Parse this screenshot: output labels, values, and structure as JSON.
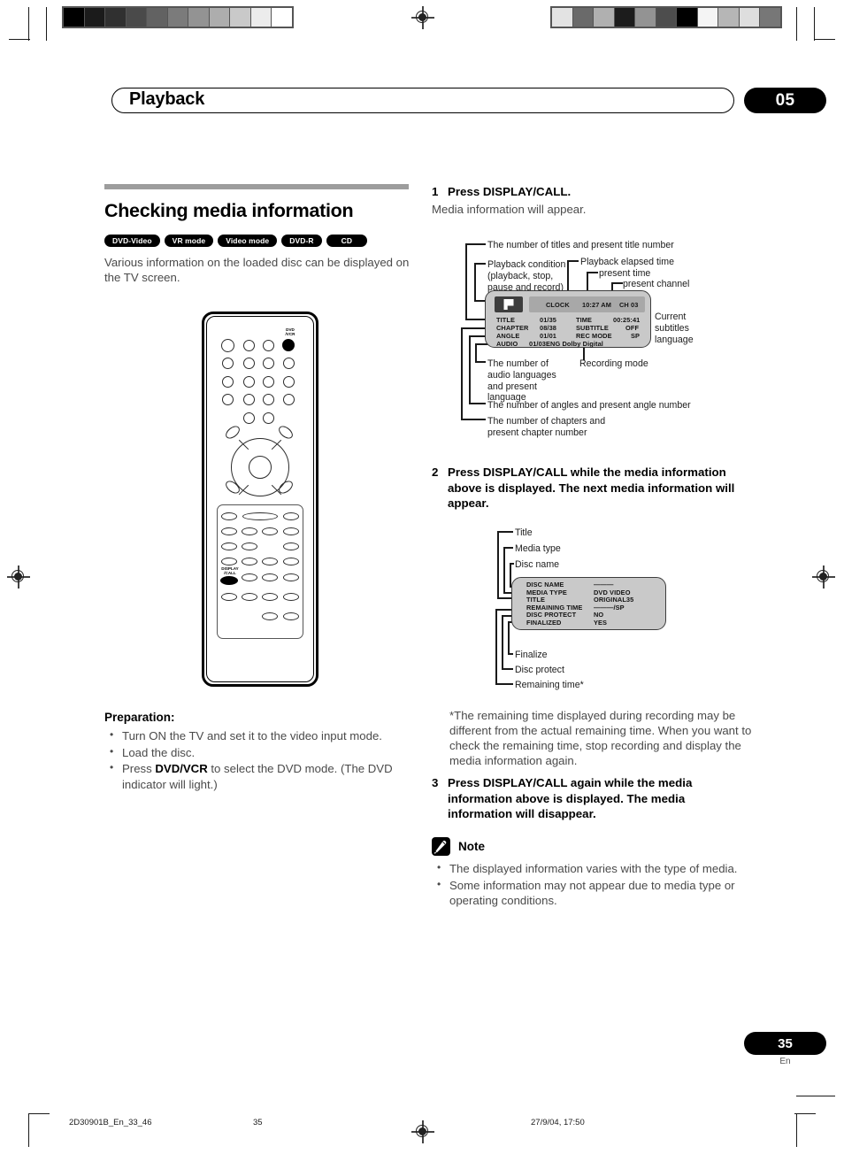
{
  "header": {
    "chapter_title": "Playback",
    "chapter_number": "05"
  },
  "left_column": {
    "section_title": "Checking media information",
    "badges": [
      {
        "label": "DVD-Video"
      },
      {
        "label": "VR mode"
      },
      {
        "label": "Video mode"
      },
      {
        "label": "DVD-R"
      },
      {
        "label": "CD"
      }
    ],
    "intro": "Various information on the loaded disc can be displayed on the TV screen.",
    "preparation_heading": "Preparation:",
    "preparation_items": [
      "Turn ON the TV and set it to the video input mode.",
      "Load the disc."
    ],
    "preparation_item_3_pre": "Press ",
    "preparation_item_3_bold": "DVD/VCR",
    "preparation_item_3_post": " to select the DVD mode. (The DVD indicator will light.)"
  },
  "remote": {
    "label_dvd_vcr": "DVD\n/VCR",
    "label_display_call": "DISPLAY\n/CALL"
  },
  "right_column": {
    "step1": {
      "number": "1",
      "text": "Press DISPLAY/CALL.",
      "sub": "Media information will appear."
    },
    "step2": {
      "number": "2",
      "text": "Press DISPLAY/CALL while the media information above is displayed. The next media information will appear."
    },
    "step3": {
      "number": "3",
      "text": "Press DISPLAY/CALL again while the media information above is displayed. The media information will disappear."
    },
    "footnote": "*The remaining time displayed during recording may be different from the actual remaining time. When you want to check the remaining time, stop recording and display the media information again.",
    "note": {
      "label": "Note",
      "items": [
        "The displayed information varies with the type of media.",
        "Some information may not appear due to media type or operating conditions."
      ]
    }
  },
  "figure1": {
    "callouts": {
      "titles": "The number of titles and present title number",
      "playback_condition": "Playback condition\n(playback, stop,\npause and record)",
      "elapsed": "Playback elapsed time",
      "present_time": "present time",
      "present_channel": "present channel",
      "current_subtitles": "Current\nsubtitles\nlanguage",
      "recording_mode": "Recording mode",
      "audio_langs": "The number of\naudio languages\nand present\nlanguage",
      "angles": "The number of angles and present angle number",
      "chapters": "The number of chapters and\npresent chapter number"
    },
    "osd": {
      "clock_label": "CLOCK",
      "clock_time": "10:27 AM",
      "channel": "CH 03",
      "rows_left": [
        {
          "label": "TITLE",
          "value": "01/35"
        },
        {
          "label": "CHAPTER",
          "value": "08/38"
        },
        {
          "label": "ANGLE",
          "value": "01/01"
        },
        {
          "label": "AUDIO",
          "value": "01/03ENG Dolby Digital"
        }
      ],
      "rows_right": [
        {
          "label": "TIME",
          "value": "00:25:41"
        },
        {
          "label": "SUBTITLE",
          "value": "OFF"
        },
        {
          "label": "REC MODE",
          "value": "SP"
        }
      ]
    }
  },
  "figure2": {
    "callouts": {
      "title": "Title",
      "media_type": "Media type",
      "disc_name": "Disc name",
      "finalize": "Finalize",
      "disc_protect": "Disc protect",
      "remaining_time": "Remaining time*"
    },
    "osd_rows": [
      {
        "label": "DISC NAME",
        "value": "———"
      },
      {
        "label": "MEDIA TYPE",
        "value": "DVD VIDEO"
      },
      {
        "label": "TITLE",
        "value": "ORIGINAL35"
      },
      {
        "label": "REMAINING TIME",
        "value": "———/SP"
      },
      {
        "label": "DISC PROTECT",
        "value": "NO"
      },
      {
        "label": "FINALIZED",
        "value": "YES"
      }
    ]
  },
  "footer": {
    "page_number": "35",
    "language": "En",
    "imprint_file": "2D30901B_En_33_46",
    "imprint_page": "35",
    "imprint_date": "27/9/04, 17:50"
  },
  "calibration": {
    "left_swatches": [
      "#000000",
      "#1b1b1b",
      "#303030",
      "#4a4a4a",
      "#626262",
      "#7b7b7b",
      "#939393",
      "#adadad",
      "#c9c9c9",
      "#ececec",
      "#ffffff"
    ],
    "right_swatches": [
      "#e3e3e3",
      "#6a6a6a",
      "#b0b0b0",
      "#1c1c1c",
      "#939393",
      "#4d4d4d",
      "#000000",
      "#f4f4f4",
      "#b6b6b6",
      "#dedede",
      "#777777"
    ]
  }
}
